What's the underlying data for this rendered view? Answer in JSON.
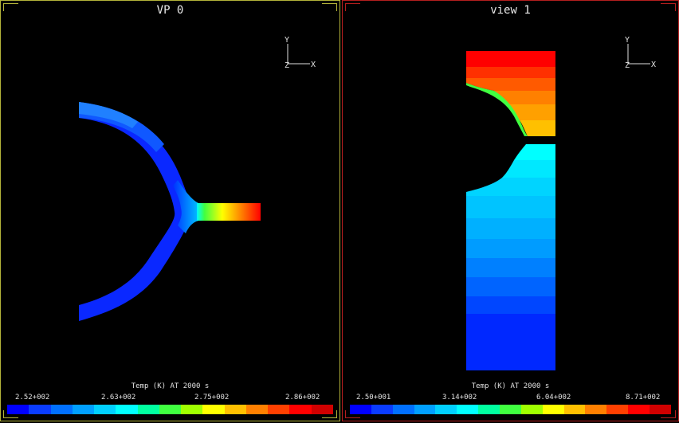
{
  "viewports": [
    {
      "title": "VP 0",
      "axis_labels": {
        "y": "Y",
        "x": "X",
        "z": "Z"
      },
      "colorbar": {
        "title": "Temp (K) AT 2000 s",
        "labels": [
          "2.52+002",
          "2.63+002",
          "2.75+002",
          "2.86+002"
        ]
      }
    },
    {
      "title": "view 1",
      "axis_labels": {
        "y": "Y",
        "x": "X",
        "z": "Z"
      },
      "colorbar": {
        "title": "Temp (K) AT 2000 s",
        "labels": [
          "2.50+001",
          "3.14+002",
          "6.04+002",
          "8.71+002"
        ]
      }
    }
  ],
  "colors": {
    "vp0_border": "#b4b43a",
    "vp1_border": "#b41e1e",
    "colormap": [
      "#0000ff",
      "#0a3cff",
      "#0070ff",
      "#00a0ff",
      "#00d0ff",
      "#00ffff",
      "#00ffa0",
      "#40ff40",
      "#a0ff00",
      "#ffff00",
      "#ffc000",
      "#ff8000",
      "#ff4000",
      "#ff0000",
      "#d00000"
    ]
  }
}
